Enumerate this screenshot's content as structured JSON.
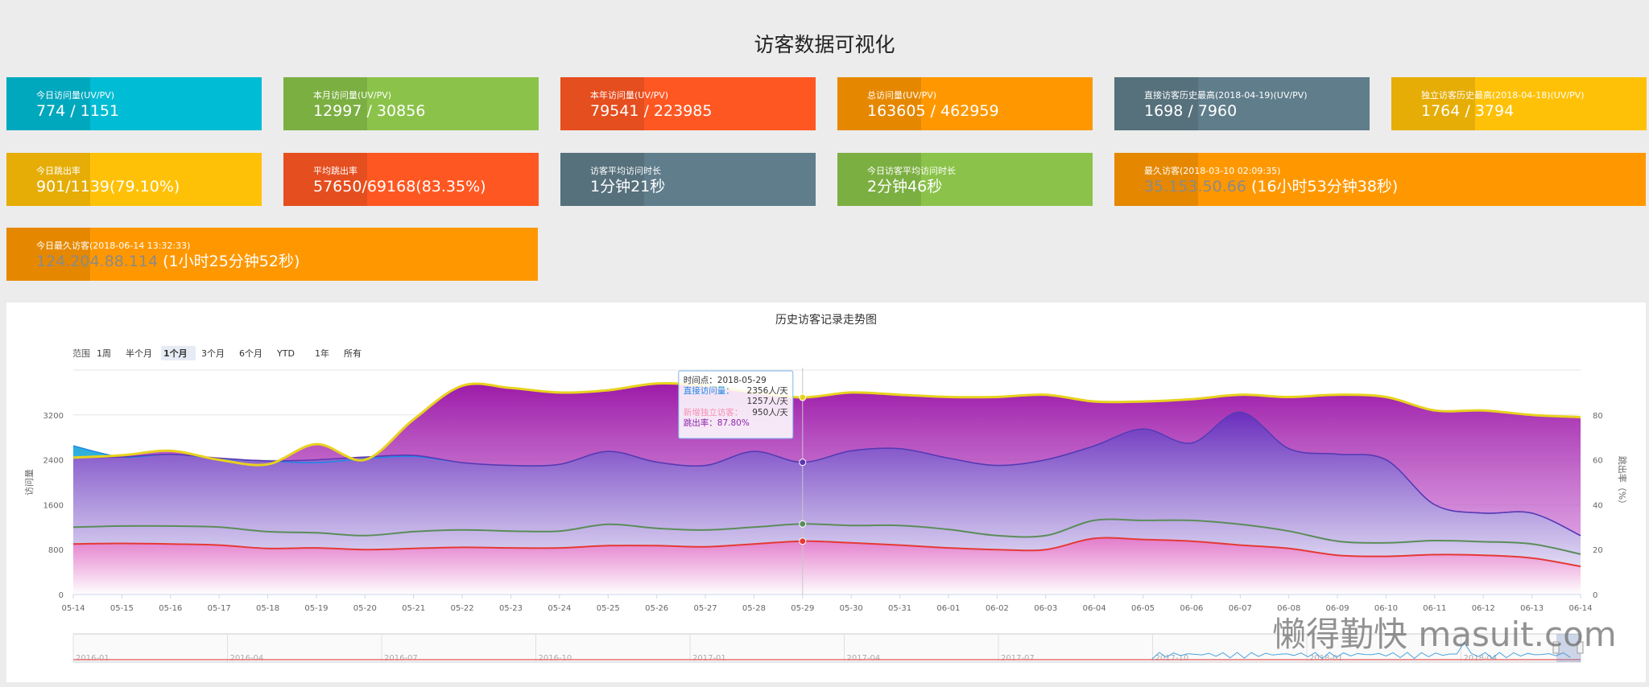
{
  "page_title": "访客数据可视化",
  "cards": [
    {
      "label": "今日访问量(UV/PV)",
      "value": "774 / 1151",
      "color": "#00bcd4"
    },
    {
      "label": "本月访问量(UV/PV)",
      "value": "12997 / 30856",
      "color": "#8bc34a"
    },
    {
      "label": "本年访问量(UV/PV)",
      "value": "79541 / 223985",
      "color": "#ff5722"
    },
    {
      "label": "总访问量(UV/PV)",
      "value": "163605 / 462959",
      "color": "#ff9800"
    },
    {
      "label": "直接访客历史最高(2018-04-19)(UV/PV)",
      "value": "1698 / 7960",
      "color": "#607d8b"
    },
    {
      "label": "独立访客历史最高(2018-04-18)(UV/PV)",
      "value": "1764 / 3794",
      "color": "#ffc107"
    },
    {
      "label": "今日跳出率",
      "value": "901/1139(79.10%)",
      "color": "#ffc107"
    },
    {
      "label": "平均跳出率",
      "value": "57650/69168(83.35%)",
      "color": "#ff5722"
    },
    {
      "label": "访客平均访问时长",
      "value": "1分钟21秒",
      "color": "#607d8b"
    },
    {
      "label": "今日访客平均访问时长",
      "value": "2分钟46秒",
      "color": "#8bc34a"
    },
    {
      "label": "最久访客(2018-03-10 02:09:35)",
      "ip": "35.153.50.66",
      "value": " (16小时53分钟38秒)",
      "color": "#ff9800"
    },
    {
      "label": "今日最久访客(2018-06-14 13:32:33)",
      "ip": "124.204.88.114",
      "value": " (1小时25分钟52秒)",
      "color": "#ff9800"
    }
  ],
  "range_selector": {
    "label": "范围",
    "buttons": [
      "1周",
      "半个月",
      "1个月",
      "3个月",
      "6个月",
      "YTD",
      "1年",
      "所有"
    ],
    "selected": "1个月"
  },
  "tooltip": {
    "time_label": "时间点：",
    "time_value": "2018-05-29",
    "direct_label": "直接访问量：",
    "direct_value": "2356人/天",
    "direct_value2": "1257人/天",
    "new_label": "新增独立访客：",
    "new_value": "950人/天",
    "bounce_label": "跳出率：",
    "bounce_value": "87.80%"
  },
  "navigator": {
    "labels": [
      "2016-01",
      "2016-04",
      "2016-07",
      "2016-10",
      "2017-01",
      "2017-04",
      "2017-07",
      "2017-10",
      "2018-01",
      "2018-04"
    ]
  },
  "watermark": "懒得勤快  masuit.com",
  "chart_data": {
    "type": "area",
    "title": "历史访客记录走势图",
    "ylabel": "访问量",
    "y2label": "跳出率（%）",
    "ylim": [
      0,
      4000
    ],
    "y2lim": [
      0,
      100
    ],
    "yticks": [
      0,
      800,
      1600,
      2400,
      3200
    ],
    "y2ticks": [
      0,
      20,
      40,
      60,
      80
    ],
    "x": [
      "05-14",
      "05-15",
      "05-16",
      "05-17",
      "05-18",
      "05-19",
      "05-20",
      "05-21",
      "05-22",
      "05-23",
      "05-24",
      "05-25",
      "05-26",
      "05-27",
      "05-28",
      "05-29",
      "05-30",
      "05-31",
      "06-01",
      "06-02",
      "06-03",
      "06-04",
      "06-05",
      "06-06",
      "06-07",
      "06-08",
      "06-09",
      "06-10",
      "06-11",
      "06-12",
      "06-13",
      "06-14"
    ],
    "series": [
      {
        "axis": "left",
        "color": "#9c27b0",
        "values": [
          2450,
          2450,
          2500,
          2430,
          2380,
          2400,
          2450,
          2480,
          2350,
          2300,
          2320,
          2550,
          2360,
          2300,
          2550,
          2356,
          2560,
          2600,
          2430,
          2300,
          2400,
          2650,
          2950,
          2700,
          3250,
          2600,
          2500,
          2400,
          1600,
          1450,
          1450,
          1050
        ]
      },
      {
        "axis": "left",
        "color": "#2196f3",
        "values": [
          2650,
          2450,
          2500,
          2420,
          2380,
          2350,
          2420,
          2460,
          2350,
          2300,
          2320,
          2550,
          2360,
          2300,
          2550,
          2356,
          2560,
          2600,
          2430,
          2300,
          2400,
          2650,
          2950,
          2700,
          3250,
          2600,
          2500,
          2400,
          1600,
          1450,
          1450,
          1050
        ]
      },
      {
        "axis": "left",
        "color": "#5b8c59",
        "values": [
          1200,
          1220,
          1220,
          1200,
          1120,
          1100,
          1050,
          1120,
          1150,
          1130,
          1130,
          1250,
          1180,
          1150,
          1200,
          1257,
          1230,
          1230,
          1160,
          1050,
          1050,
          1320,
          1320,
          1320,
          1250,
          1130,
          950,
          920,
          960,
          940,
          900,
          720
        ]
      },
      {
        "axis": "left",
        "color": "#e53935",
        "values": [
          900,
          910,
          900,
          880,
          820,
          830,
          800,
          820,
          840,
          830,
          830,
          870,
          870,
          850,
          900,
          950,
          920,
          880,
          830,
          800,
          800,
          1000,
          980,
          950,
          880,
          820,
          700,
          680,
          710,
          700,
          650,
          500
        ]
      },
      {
        "axis": "right",
        "color": "#e8d21d",
        "values": [
          61,
          62,
          64,
          60,
          58,
          67,
          60,
          78,
          93,
          92,
          90,
          91,
          94,
          93,
          90,
          87.8,
          90,
          89,
          88,
          88,
          89,
          86,
          86,
          87,
          89,
          88,
          89,
          88,
          82,
          82,
          80,
          79
        ]
      }
    ]
  }
}
